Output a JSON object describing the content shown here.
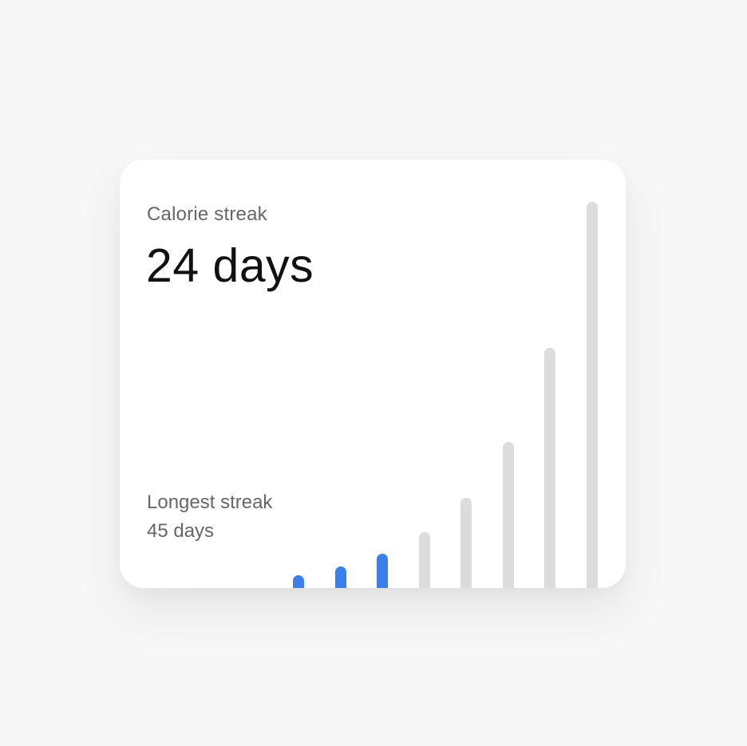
{
  "card": {
    "title": "Calorie streak",
    "value": "24 days",
    "longest_label": "Longest streak",
    "longest_value": "45 days"
  },
  "colors": {
    "active": "#3d7fe8",
    "inactive": "#dcdcdc",
    "background": "#f7f7f7",
    "card": "#ffffff"
  },
  "chart_data": {
    "type": "bar",
    "series": [
      {
        "values": [
          3,
          5,
          8,
          13,
          21,
          34,
          56,
          90
        ],
        "active": [
          true,
          true,
          true,
          false,
          false,
          false,
          false,
          false
        ]
      }
    ]
  }
}
